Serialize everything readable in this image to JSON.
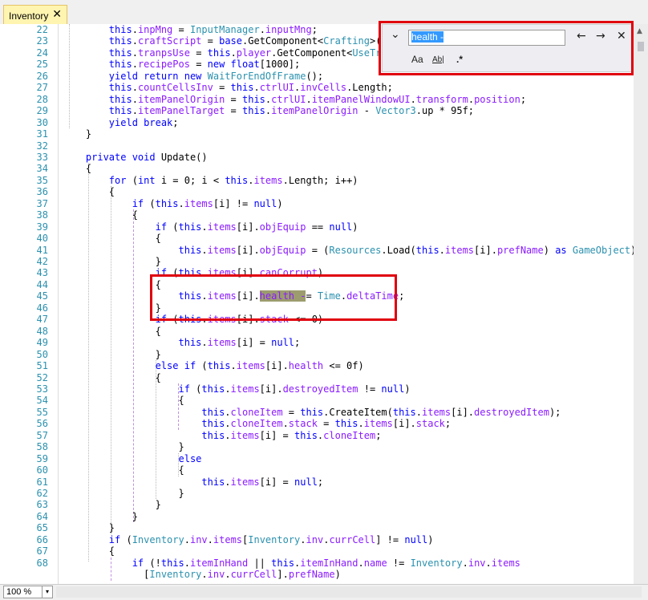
{
  "tab": {
    "label": "Inventory",
    "close": "✕"
  },
  "find": {
    "expand_glyph": "⌄",
    "value": "health -",
    "prev": "←",
    "next": "→",
    "close": "✕",
    "match_case": "Aa",
    "whole_word": "Ab|",
    "regex": ".*"
  },
  "zoom": {
    "value": "100 %",
    "dropdown": "▾"
  },
  "colors": {
    "accent_red": "#e0000e",
    "keyword": "#0000ff",
    "type": "#2b91af",
    "member": "#8a1bff",
    "highlight": "#9c9c6e"
  },
  "lines": [
    {
      "n": "22",
      "segs": [
        [
          "",
          "        "
        ],
        [
          "kw",
          "this"
        ],
        [
          "",
          "."
        ],
        [
          "mem",
          "inpMng"
        ],
        [
          "",
          " = "
        ],
        [
          "ty",
          "InputManager"
        ],
        [
          "",
          "."
        ],
        [
          "mem",
          "inputMng"
        ],
        [
          "",
          ";"
        ]
      ]
    },
    {
      "n": "23",
      "segs": [
        [
          "",
          "        "
        ],
        [
          "kw",
          "this"
        ],
        [
          "",
          "."
        ],
        [
          "mem",
          "craftScript"
        ],
        [
          "",
          " = "
        ],
        [
          "kw",
          "base"
        ],
        [
          "",
          ".GetComponent<"
        ],
        [
          "ty",
          "Crafting"
        ],
        [
          "",
          ">();"
        ]
      ]
    },
    {
      "n": "24",
      "segs": [
        [
          "",
          "        "
        ],
        [
          "kw",
          "this"
        ],
        [
          "",
          "."
        ],
        [
          "mem",
          "tranpsUse"
        ],
        [
          "",
          " = "
        ],
        [
          "kw",
          "this"
        ],
        [
          "",
          "."
        ],
        [
          "mem",
          "player"
        ],
        [
          "",
          ".GetComponent<"
        ],
        [
          "ty",
          "UseTrans"
        ]
      ]
    },
    {
      "n": "25",
      "segs": [
        [
          "",
          "        "
        ],
        [
          "kw",
          "this"
        ],
        [
          "",
          "."
        ],
        [
          "mem",
          "recipePos"
        ],
        [
          "",
          " = "
        ],
        [
          "kw",
          "new float"
        ],
        [
          "",
          "[1000];"
        ]
      ]
    },
    {
      "n": "26",
      "segs": [
        [
          "",
          "        "
        ],
        [
          "kw",
          "yield return new "
        ],
        [
          "ty",
          "WaitForEndOfFrame"
        ],
        [
          "",
          "();"
        ]
      ]
    },
    {
      "n": "27",
      "segs": [
        [
          "",
          "        "
        ],
        [
          "kw",
          "this"
        ],
        [
          "",
          "."
        ],
        [
          "mem",
          "countCellsInv"
        ],
        [
          "",
          " = "
        ],
        [
          "kw",
          "this"
        ],
        [
          "",
          "."
        ],
        [
          "mem",
          "ctrlUI"
        ],
        [
          "",
          "."
        ],
        [
          "mem",
          "invCells"
        ],
        [
          "",
          ".Length;"
        ]
      ]
    },
    {
      "n": "28",
      "segs": [
        [
          "",
          "        "
        ],
        [
          "kw",
          "this"
        ],
        [
          "",
          "."
        ],
        [
          "mem",
          "itemPanelOrigin"
        ],
        [
          "",
          " = "
        ],
        [
          "kw",
          "this"
        ],
        [
          "",
          "."
        ],
        [
          "mem",
          "ctrlUI"
        ],
        [
          "",
          "."
        ],
        [
          "mem",
          "itemPanelWindowUI"
        ],
        [
          "",
          "."
        ],
        [
          "mem",
          "transform"
        ],
        [
          "",
          "."
        ],
        [
          "mem",
          "position"
        ],
        [
          "",
          ";"
        ]
      ]
    },
    {
      "n": "29",
      "segs": [
        [
          "",
          "        "
        ],
        [
          "kw",
          "this"
        ],
        [
          "",
          "."
        ],
        [
          "mem",
          "itemPanelTarget"
        ],
        [
          "",
          " = "
        ],
        [
          "kw",
          "this"
        ],
        [
          "",
          "."
        ],
        [
          "mem",
          "itemPanelOrigin"
        ],
        [
          "",
          " - "
        ],
        [
          "ty",
          "Vector3"
        ],
        [
          "",
          ".up * 95f;"
        ]
      ]
    },
    {
      "n": "30",
      "segs": [
        [
          "",
          "        "
        ],
        [
          "kw",
          "yield break"
        ],
        [
          "",
          ";"
        ]
      ]
    },
    {
      "n": "31",
      "segs": [
        [
          "",
          "    }"
        ]
      ]
    },
    {
      "n": "32",
      "segs": [
        [
          "",
          ""
        ]
      ]
    },
    {
      "n": "33",
      "segs": [
        [
          "",
          "    "
        ],
        [
          "kw",
          "private void "
        ],
        [
          "",
          "Update()"
        ]
      ]
    },
    {
      "n": "34",
      "segs": [
        [
          "",
          "    {"
        ]
      ]
    },
    {
      "n": "35",
      "segs": [
        [
          "",
          "        "
        ],
        [
          "kw",
          "for"
        ],
        [
          "",
          " ("
        ],
        [
          "kw",
          "int"
        ],
        [
          "",
          " i = 0; i < "
        ],
        [
          "kw",
          "this"
        ],
        [
          "",
          "."
        ],
        [
          "mem",
          "items"
        ],
        [
          "",
          ".Length; i++)"
        ]
      ]
    },
    {
      "n": "36",
      "segs": [
        [
          "",
          "        {"
        ]
      ]
    },
    {
      "n": "37",
      "segs": [
        [
          "",
          "            "
        ],
        [
          "kw",
          "if"
        ],
        [
          "",
          " ("
        ],
        [
          "kw",
          "this"
        ],
        [
          "",
          "."
        ],
        [
          "mem",
          "items"
        ],
        [
          "",
          "[i] != "
        ],
        [
          "kw",
          "null"
        ],
        [
          "",
          ")"
        ]
      ]
    },
    {
      "n": "38",
      "segs": [
        [
          "",
          "            {"
        ]
      ]
    },
    {
      "n": "39",
      "segs": [
        [
          "",
          "                "
        ],
        [
          "kw",
          "if"
        ],
        [
          "",
          " ("
        ],
        [
          "kw",
          "this"
        ],
        [
          "",
          "."
        ],
        [
          "mem",
          "items"
        ],
        [
          "",
          "[i]."
        ],
        [
          "mem",
          "objEquip"
        ],
        [
          "",
          " == "
        ],
        [
          "kw",
          "null"
        ],
        [
          "",
          ")"
        ]
      ]
    },
    {
      "n": "40",
      "segs": [
        [
          "",
          "                {"
        ]
      ]
    },
    {
      "n": "41",
      "segs": [
        [
          "",
          "                    "
        ],
        [
          "kw",
          "this"
        ],
        [
          "",
          "."
        ],
        [
          "mem",
          "items"
        ],
        [
          "",
          "[i]."
        ],
        [
          "mem",
          "objEquip"
        ],
        [
          "",
          " = ("
        ],
        [
          "ty",
          "Resources"
        ],
        [
          "",
          ".Load("
        ],
        [
          "kw",
          "this"
        ],
        [
          "",
          "."
        ],
        [
          "mem",
          "items"
        ],
        [
          "",
          "[i]."
        ],
        [
          "mem",
          "prefName"
        ],
        [
          "",
          ") "
        ],
        [
          "kw",
          "as "
        ],
        [
          "ty",
          "GameObject"
        ],
        [
          "",
          ");"
        ]
      ]
    },
    {
      "n": "42",
      "segs": [
        [
          "",
          "                }"
        ]
      ]
    },
    {
      "n": "43",
      "segs": [
        [
          "",
          "                "
        ],
        [
          "kw",
          "if"
        ],
        [
          "",
          " ("
        ],
        [
          "kw",
          "this"
        ],
        [
          "",
          "."
        ],
        [
          "mem",
          "items"
        ],
        [
          "",
          "[i]."
        ],
        [
          "mem",
          "canCorrupt"
        ],
        [
          "",
          ")"
        ]
      ]
    },
    {
      "n": "44",
      "segs": [
        [
          "",
          "                {"
        ]
      ]
    },
    {
      "n": "45",
      "segs": [
        [
          "",
          "                    "
        ],
        [
          "kw",
          "this"
        ],
        [
          "",
          "."
        ],
        [
          "mem",
          "items"
        ],
        [
          "",
          "[i]."
        ],
        [
          "hl",
          "health -"
        ],
        [
          "",
          "= "
        ],
        [
          "ty",
          "Time"
        ],
        [
          "",
          "."
        ],
        [
          "mem",
          "deltaTime"
        ],
        [
          "",
          ";"
        ]
      ]
    },
    {
      "n": "46",
      "segs": [
        [
          "",
          "                }"
        ]
      ]
    },
    {
      "n": "47",
      "segs": [
        [
          "",
          "                "
        ],
        [
          "kw",
          "if"
        ],
        [
          "",
          " ("
        ],
        [
          "kw",
          "this"
        ],
        [
          "",
          "."
        ],
        [
          "mem",
          "items"
        ],
        [
          "",
          "[i]."
        ],
        [
          "mem",
          "stack"
        ],
        [
          "",
          " <= 0)"
        ]
      ]
    },
    {
      "n": "48",
      "segs": [
        [
          "",
          "                {"
        ]
      ]
    },
    {
      "n": "49",
      "segs": [
        [
          "",
          "                    "
        ],
        [
          "kw",
          "this"
        ],
        [
          "",
          "."
        ],
        [
          "mem",
          "items"
        ],
        [
          "",
          "[i] = "
        ],
        [
          "kw",
          "null"
        ],
        [
          "",
          ";"
        ]
      ]
    },
    {
      "n": "50",
      "segs": [
        [
          "",
          "                }"
        ]
      ]
    },
    {
      "n": "51",
      "segs": [
        [
          "",
          "                "
        ],
        [
          "kw",
          "else if"
        ],
        [
          "",
          " ("
        ],
        [
          "kw",
          "this"
        ],
        [
          "",
          "."
        ],
        [
          "mem",
          "items"
        ],
        [
          "",
          "[i]."
        ],
        [
          "mem",
          "health"
        ],
        [
          "",
          " <= 0f)"
        ]
      ]
    },
    {
      "n": "52",
      "segs": [
        [
          "",
          "                {"
        ]
      ]
    },
    {
      "n": "53",
      "segs": [
        [
          "",
          "                    "
        ],
        [
          "kw",
          "if"
        ],
        [
          "",
          " ("
        ],
        [
          "kw",
          "this"
        ],
        [
          "",
          "."
        ],
        [
          "mem",
          "items"
        ],
        [
          "",
          "[i]."
        ],
        [
          "mem",
          "destroyedItem"
        ],
        [
          "",
          " != "
        ],
        [
          "kw",
          "null"
        ],
        [
          "",
          ")"
        ]
      ]
    },
    {
      "n": "54",
      "segs": [
        [
          "",
          "                    {"
        ]
      ]
    },
    {
      "n": "55",
      "segs": [
        [
          "",
          "                        "
        ],
        [
          "kw",
          "this"
        ],
        [
          "",
          "."
        ],
        [
          "mem",
          "cloneItem"
        ],
        [
          "",
          " = "
        ],
        [
          "kw",
          "this"
        ],
        [
          "",
          ".CreateItem("
        ],
        [
          "kw",
          "this"
        ],
        [
          "",
          "."
        ],
        [
          "mem",
          "items"
        ],
        [
          "",
          "[i]."
        ],
        [
          "mem",
          "destroyedItem"
        ],
        [
          "",
          ");"
        ]
      ]
    },
    {
      "n": "56",
      "segs": [
        [
          "",
          "                        "
        ],
        [
          "kw",
          "this"
        ],
        [
          "",
          "."
        ],
        [
          "mem",
          "cloneItem"
        ],
        [
          "",
          "."
        ],
        [
          "mem",
          "stack"
        ],
        [
          "",
          " = "
        ],
        [
          "kw",
          "this"
        ],
        [
          "",
          "."
        ],
        [
          "mem",
          "items"
        ],
        [
          "",
          "[i]."
        ],
        [
          "mem",
          "stack"
        ],
        [
          "",
          ";"
        ]
      ]
    },
    {
      "n": "57",
      "segs": [
        [
          "",
          "                        "
        ],
        [
          "kw",
          "this"
        ],
        [
          "",
          "."
        ],
        [
          "mem",
          "items"
        ],
        [
          "",
          "[i] = "
        ],
        [
          "kw",
          "this"
        ],
        [
          "",
          "."
        ],
        [
          "mem",
          "cloneItem"
        ],
        [
          "",
          ";"
        ]
      ]
    },
    {
      "n": "58",
      "segs": [
        [
          "",
          "                    }"
        ]
      ]
    },
    {
      "n": "59",
      "segs": [
        [
          "",
          "                    "
        ],
        [
          "kw",
          "else"
        ]
      ]
    },
    {
      "n": "60",
      "segs": [
        [
          "",
          "                    {"
        ]
      ]
    },
    {
      "n": "61",
      "segs": [
        [
          "",
          "                        "
        ],
        [
          "kw",
          "this"
        ],
        [
          "",
          "."
        ],
        [
          "mem",
          "items"
        ],
        [
          "",
          "[i] = "
        ],
        [
          "kw",
          "null"
        ],
        [
          "",
          ";"
        ]
      ]
    },
    {
      "n": "62",
      "segs": [
        [
          "",
          "                    }"
        ]
      ]
    },
    {
      "n": "63",
      "segs": [
        [
          "",
          "                }"
        ]
      ]
    },
    {
      "n": "64",
      "segs": [
        [
          "",
          "            }"
        ]
      ]
    },
    {
      "n": "65",
      "segs": [
        [
          "",
          "        }"
        ]
      ]
    },
    {
      "n": "66",
      "segs": [
        [
          "",
          "        "
        ],
        [
          "kw",
          "if"
        ],
        [
          "",
          " ("
        ],
        [
          "ty",
          "Inventory"
        ],
        [
          "",
          "."
        ],
        [
          "mem",
          "inv"
        ],
        [
          "",
          "."
        ],
        [
          "mem",
          "items"
        ],
        [
          "",
          "["
        ],
        [
          "ty",
          "Inventory"
        ],
        [
          "",
          "."
        ],
        [
          "mem",
          "inv"
        ],
        [
          "",
          "."
        ],
        [
          "mem",
          "currCell"
        ],
        [
          "",
          "] != "
        ],
        [
          "kw",
          "null"
        ],
        [
          "",
          ")"
        ]
      ]
    },
    {
      "n": "67",
      "segs": [
        [
          "",
          "        {"
        ]
      ]
    },
    {
      "n": "68",
      "segs": [
        [
          "",
          "            "
        ],
        [
          "kw",
          "if"
        ],
        [
          "",
          " (!"
        ],
        [
          "kw",
          "this"
        ],
        [
          "",
          "."
        ],
        [
          "mem",
          "itemInHand"
        ],
        [
          "",
          " || "
        ],
        [
          "kw",
          "this"
        ],
        [
          "",
          "."
        ],
        [
          "mem",
          "itemInHand"
        ],
        [
          "",
          "."
        ],
        [
          "mem",
          "name"
        ],
        [
          "",
          " != "
        ],
        [
          "ty",
          "Inventory"
        ],
        [
          "",
          "."
        ],
        [
          "mem",
          "inv"
        ],
        [
          "",
          "."
        ],
        [
          "mem",
          "items"
        ]
      ]
    },
    {
      "n": "",
      "segs": [
        [
          "",
          "              ["
        ],
        [
          "ty",
          "Inventory"
        ],
        [
          "",
          "."
        ],
        [
          "mem",
          "inv"
        ],
        [
          "",
          "."
        ],
        [
          "mem",
          "currCell"
        ],
        [
          "",
          "]."
        ],
        [
          "mem",
          "prefName"
        ],
        [
          "",
          ")"
        ]
      ]
    }
  ]
}
